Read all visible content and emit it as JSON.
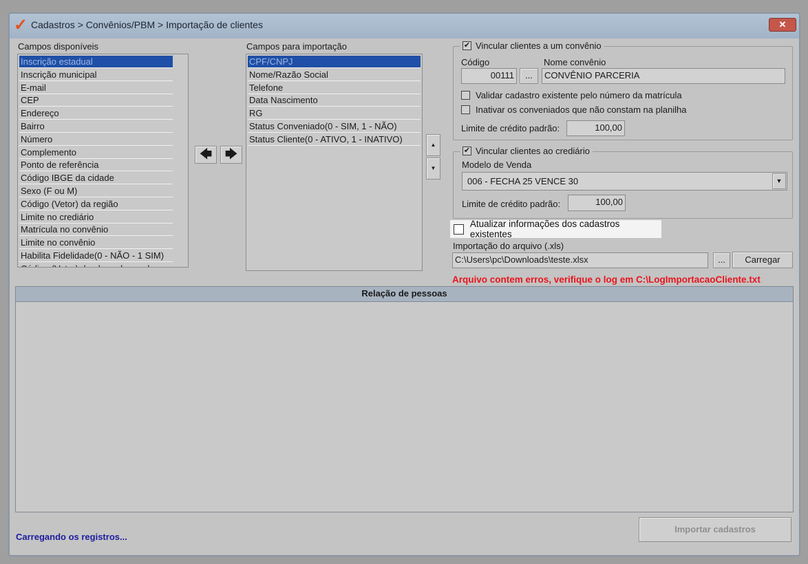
{
  "window": {
    "title": "Cadastros > Convênios/PBM > Importação de clientes",
    "logo": "✓",
    "close": "✕"
  },
  "available": {
    "label": "Campos disponíveis",
    "items": [
      "Inscrição estadual",
      "Inscrição municipal",
      "E-mail",
      "CEP",
      "Endereço",
      "Bairro",
      "Número",
      "Complemento",
      "Ponto de referência",
      "Código IBGE da cidade",
      "Sexo (F ou M)",
      "Código (Vetor) da região",
      "Limite no crediário",
      "Matrícula no convênio",
      "Limite no convênio",
      "Habilita Fidelidade(0 - NÃO - 1 SIM)",
      "Código (Vetor) do plano de venda"
    ]
  },
  "import_fields": {
    "label": "Campos para importação",
    "items": [
      "CPF/CNPJ",
      "Nome/Razão Social",
      "Telefone",
      "Data Nascimento",
      "RG",
      "Status Conveniado(0 - SIM, 1 - NÃO)",
      "Status Cliente(0 - ATIVO, 1 - INATIVO)"
    ]
  },
  "arrows": {
    "left": "🡄",
    "right": "🡆",
    "up": "▲",
    "down": "▼"
  },
  "convenio": {
    "label": "Vincular clientes a um convênio",
    "checked": true,
    "codigo_label": "Código",
    "codigo": "00111",
    "browse": "...",
    "nome_label": "Nome convênio",
    "nome": "CONVÊNIO PARCERIA",
    "validar": "Validar cadastro existente pelo número da matrícula",
    "inativar": "Inativar os conveniados que não constam na planilha",
    "limite_label": "Limite de crédito padrão:",
    "limite": "100,00"
  },
  "crediario": {
    "label": "Vincular clientes ao crediário",
    "checked": true,
    "modelo_label": "Modelo de Venda",
    "modelo": "006 - FECHA 25 VENCE 30",
    "limite_label": "Limite de crédito padrão:",
    "limite": "100,00"
  },
  "atualizar": {
    "label": "Atualizar informações dos cadastros existentes",
    "checked": false
  },
  "arquivo": {
    "label": "Importação do arquivo (.xls)",
    "path": "C:\\Users\\pc\\Downloads\\teste.xlsx",
    "browse": "...",
    "load": "Carregar"
  },
  "error": "Arquivo contem erros, verifique o log em C:\\LogImportacaoCliente.txt",
  "people": {
    "header": "Relação de pessoas"
  },
  "status": "Carregando os registros...",
  "import_button": "Importar cadastros",
  "colors": {
    "error": "#e8141c",
    "status": "#1c1ca0",
    "selection": "#1f4fa6"
  }
}
